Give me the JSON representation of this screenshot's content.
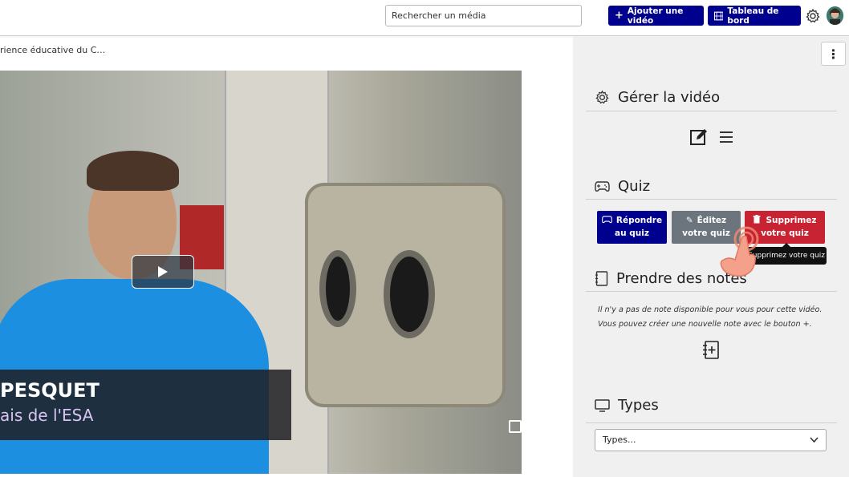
{
  "header": {
    "search_placeholder": "Rechercher un média",
    "add_video_label": "Ajouter une vidéo",
    "dashboard_label": "Tableau de bord",
    "settings_icon": "gear-icon",
    "avatar_icon": "user-avatar"
  },
  "breadcrumb": "rience éducative du C…",
  "video": {
    "lower_third_name": "PESQUET",
    "lower_third_role": "ais de l'ESA",
    "play_icon": "play-icon"
  },
  "sidebar": {
    "more_icon": "more-vertical-icon",
    "manage": {
      "title": "Gérer la vidéo",
      "icon": "gear-icon",
      "edit_icon": "edit-icon",
      "list_icon": "list-icon"
    },
    "quiz": {
      "title": "Quiz",
      "icon": "gamepad-icon",
      "answer_line1": "Répondre",
      "answer_line2": "au quiz",
      "edit_line1": "Éditez",
      "edit_line2": "votre quiz",
      "delete_line1": "Supprimez",
      "delete_line2": "votre quiz",
      "tooltip": "Supprimez votre quiz"
    },
    "notes": {
      "title": "Prendre des notes",
      "line1": "Il n'y a pas de note disponible pour vous pour cette vidéo.",
      "line2": "Vous pouvez créer une nouvelle note avec le bouton +.",
      "add_icon": "add-note-icon"
    },
    "types": {
      "title": "Types",
      "icon": "monitor-icon",
      "select_value": "Types..."
    }
  },
  "colors": {
    "primary": "#00008f",
    "secondary": "#6c757d",
    "danger": "#c82333",
    "sidebar_bg": "#f0f0f0"
  }
}
